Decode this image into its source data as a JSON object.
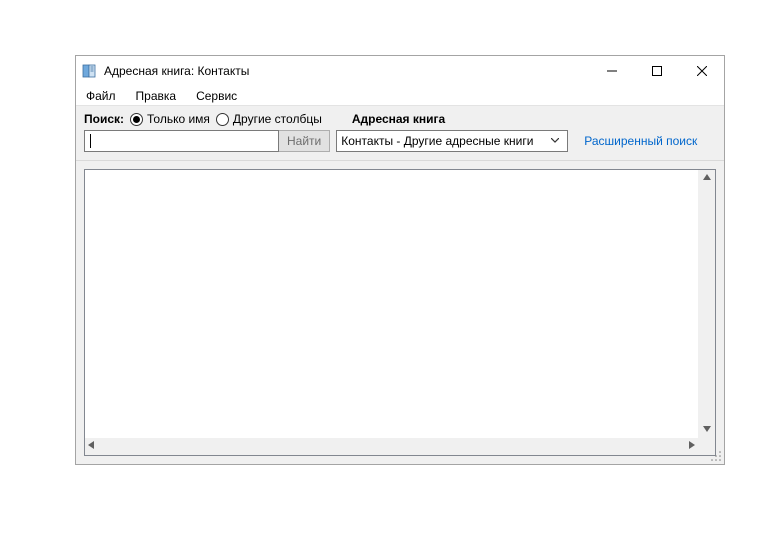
{
  "window": {
    "title": "Адресная книга: Контакты"
  },
  "menubar": {
    "file": "Файл",
    "edit": "Правка",
    "service": "Сервис"
  },
  "toolbar": {
    "search_label": "Поиск:",
    "radio_name_only": "Только имя",
    "radio_other_cols": "Другие столбцы",
    "address_book_label": "Адресная книга",
    "search_value": "",
    "find_button": "Найти",
    "selected_book": "Контакты - Другие адресные книги",
    "advanced_search": "Расширенный поиск"
  }
}
